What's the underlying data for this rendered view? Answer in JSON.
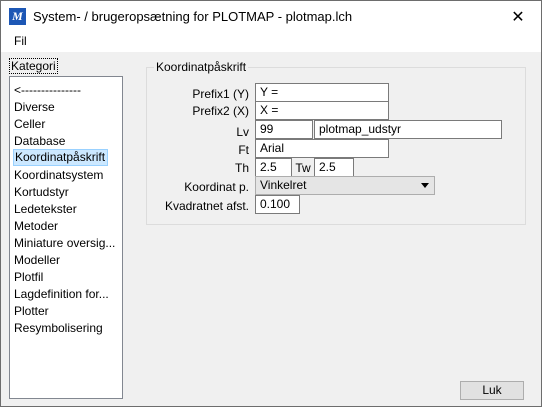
{
  "window": {
    "title": "System- / brugeropsætning for PLOTMAP - plotmap.lch",
    "icon_glyph": "M",
    "close_glyph": "✕"
  },
  "menu": {
    "file_label": "Fil"
  },
  "categories": {
    "label": "Kategori",
    "items": [
      "<---------------",
      "Diverse",
      "Celler",
      "Database",
      "Koordinatpåskrift",
      "Koordinatsystem",
      "Kortudstyr",
      "Ledetekster",
      "Metoder",
      "Miniature oversig...",
      "Modeller",
      "Plotfil",
      "Lagdefinition for...",
      "Plotter",
      "Resymbolisering"
    ],
    "selected_index": 4
  },
  "settings": {
    "group_title": "Koordinatpåskrift",
    "prefix1_label": "Prefix1 (Y)",
    "prefix1_value": "  Y =",
    "prefix2_label": "Prefix2 (X)",
    "prefix2_value": "  X =",
    "lv_label": "Lv",
    "lv_value": "99",
    "lv_name_value": "plotmap_udstyr",
    "ft_label": "Ft",
    "ft_value": "Arial",
    "th_label": "Th",
    "th_value": "2.5",
    "tw_label": "Tw",
    "tw_value": "2.5",
    "koordinat_label": "Koordinat p.",
    "koordinat_value": "Vinkelret",
    "kvadratnet_label": "Kvadratnet afst.",
    "kvadratnet_value": "0.100"
  },
  "footer": {
    "close_label": "Luk"
  }
}
